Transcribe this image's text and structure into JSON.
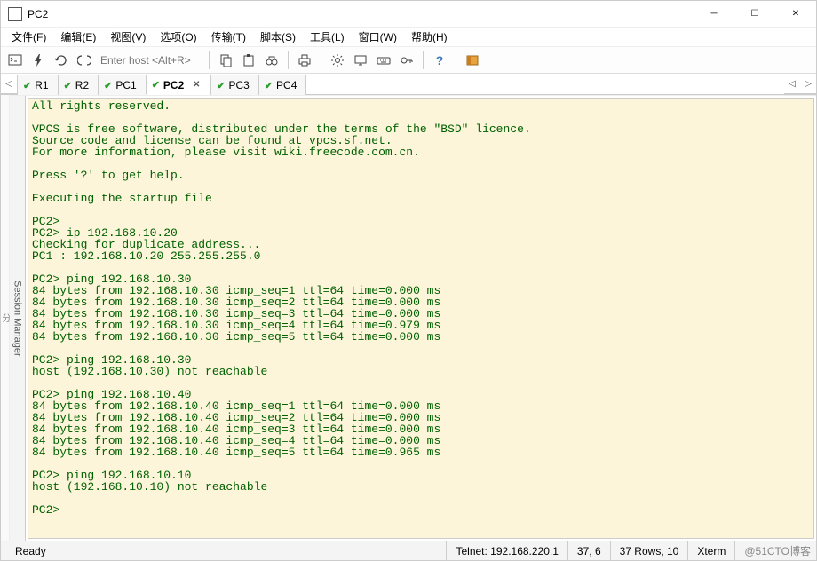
{
  "window": {
    "title": "PC2"
  },
  "menu": {
    "items": [
      "文件(F)",
      "编辑(E)",
      "视图(V)",
      "选项(O)",
      "传输(T)",
      "脚本(S)",
      "工具(L)",
      "窗口(W)",
      "帮助(H)"
    ]
  },
  "toolbar": {
    "host_placeholder": "Enter host <Alt+R>"
  },
  "tabs": [
    {
      "label": "R1",
      "active": false
    },
    {
      "label": "R2",
      "active": false
    },
    {
      "label": "PC1",
      "active": false
    },
    {
      "label": "PC2",
      "active": true
    },
    {
      "label": "PC3",
      "active": false
    },
    {
      "label": "PC4",
      "active": false
    }
  ],
  "session_manager_label": "Session Manager",
  "left_strip_char": "分",
  "terminal_lines": [
    "All rights reserved.",
    "",
    "VPCS is free software, distributed under the terms of the \"BSD\" licence.",
    "Source code and license can be found at vpcs.sf.net.",
    "For more information, please visit wiki.freecode.com.cn.",
    "",
    "Press '?' to get help.",
    "",
    "Executing the startup file",
    "",
    "PC2>",
    "PC2> ip 192.168.10.20",
    "Checking for duplicate address...",
    "PC1 : 192.168.10.20 255.255.255.0",
    "",
    "PC2> ping 192.168.10.30",
    "84 bytes from 192.168.10.30 icmp_seq=1 ttl=64 time=0.000 ms",
    "84 bytes from 192.168.10.30 icmp_seq=2 ttl=64 time=0.000 ms",
    "84 bytes from 192.168.10.30 icmp_seq=3 ttl=64 time=0.000 ms",
    "84 bytes from 192.168.10.30 icmp_seq=4 ttl=64 time=0.979 ms",
    "84 bytes from 192.168.10.30 icmp_seq=5 ttl=64 time=0.000 ms",
    "",
    "PC2> ping 192.168.10.30",
    "host (192.168.10.30) not reachable",
    "",
    "PC2> ping 192.168.10.40",
    "84 bytes from 192.168.10.40 icmp_seq=1 ttl=64 time=0.000 ms",
    "84 bytes from 192.168.10.40 icmp_seq=2 ttl=64 time=0.000 ms",
    "84 bytes from 192.168.10.40 icmp_seq=3 ttl=64 time=0.000 ms",
    "84 bytes from 192.168.10.40 icmp_seq=4 ttl=64 time=0.000 ms",
    "84 bytes from 192.168.10.40 icmp_seq=5 ttl=64 time=0.965 ms",
    "",
    "PC2> ping 192.168.10.10",
    "host (192.168.10.10) not reachable",
    "",
    "PC2>"
  ],
  "status": {
    "ready": "Ready",
    "conn": "Telnet: 192.168.220.1",
    "cursor": "37,   6",
    "size": "37 Rows, 10",
    "mode": "Xterm",
    "watermark": "@51CTO博客"
  }
}
